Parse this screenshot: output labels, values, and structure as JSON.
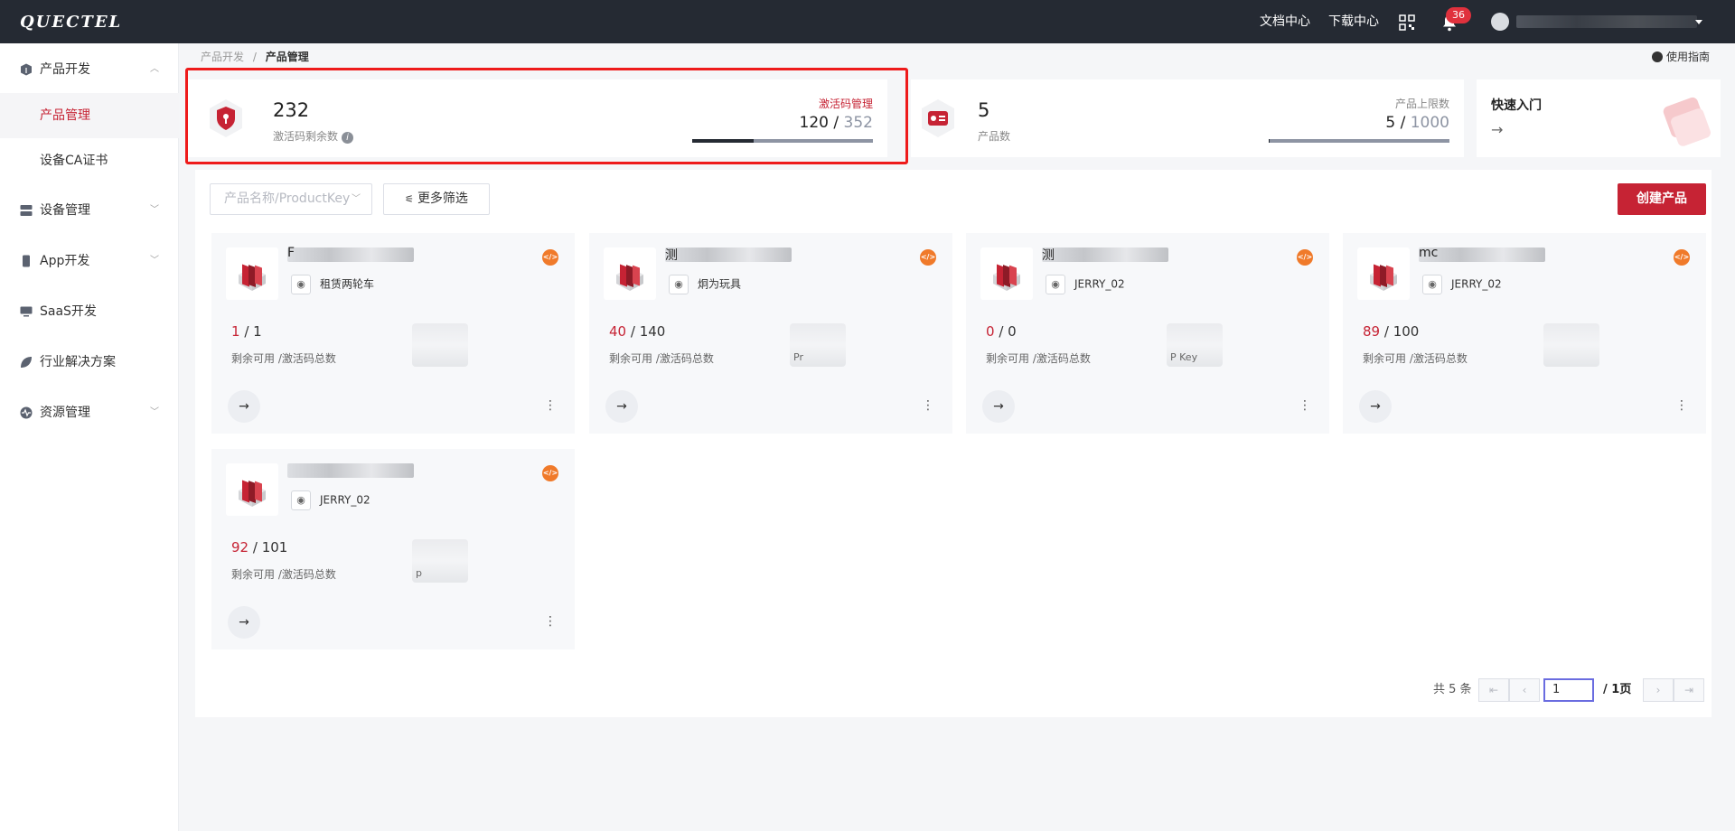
{
  "header": {
    "logo_text": "QUECTEL",
    "nav": [
      "文档中心",
      "下载中心"
    ],
    "notification_count": "36"
  },
  "sidebar": {
    "items": [
      {
        "label": "产品开发",
        "icon": "cube-icon",
        "expanded": true
      },
      {
        "label": "产品管理",
        "active": true
      },
      {
        "label": "设备CA证书"
      },
      {
        "label": "设备管理",
        "icon": "server-icon"
      },
      {
        "label": "App开发",
        "icon": "phone-icon"
      },
      {
        "label": "SaaS开发",
        "icon": "monitor-icon"
      },
      {
        "label": "行业解决方案",
        "icon": "leaf-icon"
      },
      {
        "label": "资源管理",
        "icon": "pulse-icon"
      }
    ]
  },
  "breadcrumb": {
    "parent": "产品开发",
    "sep": "/",
    "current": "产品管理"
  },
  "guide_label": "使用指南",
  "stats": {
    "activation": {
      "value": "232",
      "label": "激活码剩余数",
      "link": "激活码管理",
      "used": "120",
      "total": "352",
      "progress": 0.34
    },
    "products": {
      "value": "5",
      "label": "产品数",
      "limit_label": "产品上限数",
      "used": "5",
      "total": "1000",
      "progress": 0.005
    },
    "quickstart": {
      "title": "快速入门",
      "arrow": "→"
    }
  },
  "toolbar": {
    "search_placeholder": "产品名称/ProductKey",
    "more_filters": "更多筛选",
    "create": "创建产品"
  },
  "cards": [
    {
      "name_prefix": "F",
      "device_type": "租赁两轮车",
      "remaining": "1",
      "total": "1",
      "count_label": "剩余可用 /激活码总数",
      "pk_text": ""
    },
    {
      "name_prefix": "测",
      "device_type": "炯为玩具",
      "remaining": "40",
      "total": "140",
      "count_label": "剩余可用 /激活码总数",
      "pk_text": "Pr"
    },
    {
      "name_prefix": "测",
      "device_type": "JERRY_02",
      "remaining": "0",
      "total": "0",
      "count_label": "剩余可用 /激活码总数",
      "pk_text": "P      Key"
    },
    {
      "name_prefix": "mc",
      "device_type": "JERRY_02",
      "remaining": "89",
      "total": "100",
      "count_label": "剩余可用 /激活码总数",
      "pk_text": ""
    },
    {
      "name_prefix": "",
      "device_type": "JERRY_02",
      "remaining": "92",
      "total": "101",
      "count_label": "剩余可用 /激活码总数",
      "pk_text": "p"
    }
  ],
  "pagination": {
    "total_text": "共 5 条",
    "page": "1",
    "pages_text": "/ 1页"
  },
  "colors": {
    "brand": "#c62334",
    "header_bg": "#252a33",
    "code_badge": "#f07a2a"
  }
}
